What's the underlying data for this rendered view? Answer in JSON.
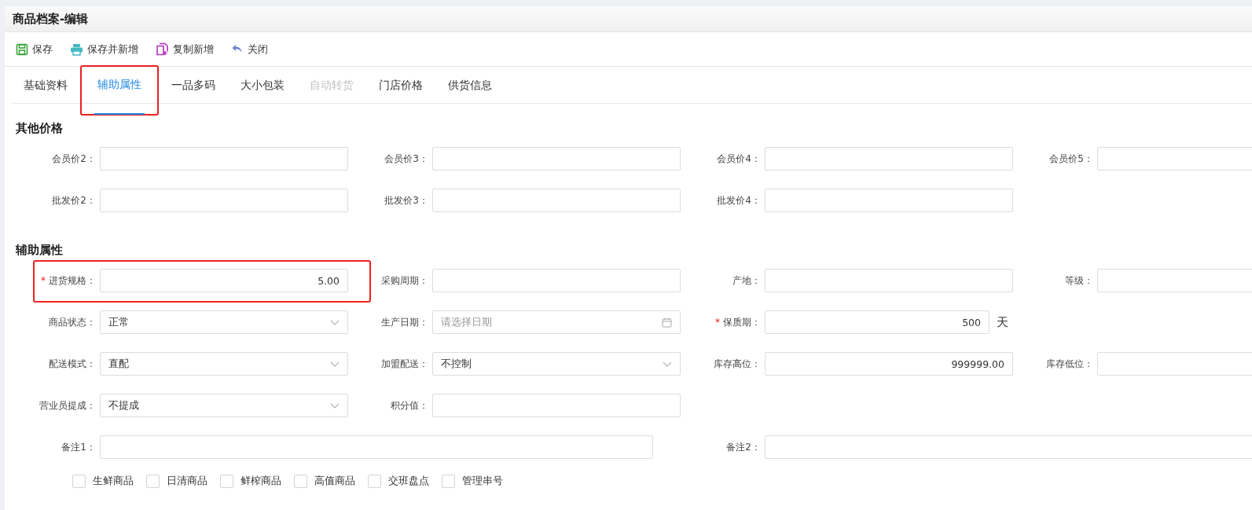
{
  "window": {
    "title": "商品档案-编辑"
  },
  "toolbar": [
    {
      "label": "保存"
    },
    {
      "label": "保存并新增"
    },
    {
      "label": "复制新增"
    },
    {
      "label": "关闭"
    }
  ],
  "tabs": [
    {
      "label": "基础资料",
      "selected": false,
      "disabled": false,
      "highlighted": false
    },
    {
      "label": "辅助属性",
      "selected": true,
      "disabled": false,
      "highlighted": true
    },
    {
      "label": "一品多码",
      "selected": false,
      "disabled": false,
      "highlighted": false
    },
    {
      "label": "大小包装",
      "selected": false,
      "disabled": false,
      "highlighted": false
    },
    {
      "label": "自动转货",
      "selected": false,
      "disabled": true,
      "highlighted": false
    },
    {
      "label": "门店价格",
      "selected": false,
      "disabled": false,
      "highlighted": false
    },
    {
      "label": "供货信息",
      "selected": false,
      "disabled": false,
      "highlighted": false
    }
  ],
  "sections": [
    {
      "title": "其他价格",
      "rows": [
        [
          {
            "label": "会员价2：",
            "kind": "text"
          },
          {
            "label": "会员价3：",
            "kind": "text"
          },
          {
            "label": "会员价4：",
            "kind": "text"
          },
          {
            "label": "会员价5：",
            "kind": "text"
          }
        ],
        [
          {
            "label": "批发价2：",
            "kind": "text"
          },
          {
            "label": "批发价3：",
            "kind": "text"
          },
          {
            "label": "批发价4：",
            "kind": "text"
          }
        ]
      ]
    },
    {
      "title": "辅助属性",
      "rows": [
        [
          {
            "label": "进货规格：",
            "kind": "text",
            "value": "5.00",
            "required_mark": "*",
            "highlighted": true
          },
          {
            "label": "采购周期：",
            "kind": "text"
          },
          {
            "label": "产地：",
            "kind": "text"
          },
          {
            "label": "等级：",
            "kind": "text"
          }
        ],
        [
          {
            "label": "商品状态：",
            "kind": "select",
            "value": "正常"
          },
          {
            "label": "生产日期：",
            "kind": "date",
            "placeholder": "请选择日期"
          },
          {
            "label": "保质期：",
            "kind": "text",
            "value": "500",
            "required_mark": "*",
            "suffix": "天"
          }
        ],
        [
          {
            "label": "配送模式：",
            "kind": "select",
            "value": "直配"
          },
          {
            "label": "加盟配送：",
            "kind": "select",
            "value": "不控制"
          },
          {
            "label": "库存高位：",
            "kind": "text",
            "value": "999999.00"
          },
          {
            "label": "库存低位：",
            "kind": "text"
          }
        ],
        [
          {
            "label": "营业员提成：",
            "kind": "select",
            "value": "不提成"
          },
          {
            "label": "积分值：",
            "kind": "text"
          }
        ],
        [
          {
            "label": "备注1：",
            "kind": "long-text"
          },
          "",
          {
            "label": "备注2：",
            "kind": "long-text"
          }
        ]
      ]
    }
  ],
  "checkboxes": [
    {
      "label": "生鲜商品",
      "checked": false
    },
    {
      "label": "日清商品",
      "checked": false
    },
    {
      "label": "鲜榨商品",
      "checked": false
    },
    {
      "label": "高值商品",
      "checked": false
    },
    {
      "label": "交班盘点",
      "checked": false
    },
    {
      "label": "管理串号",
      "checked": false
    }
  ]
}
